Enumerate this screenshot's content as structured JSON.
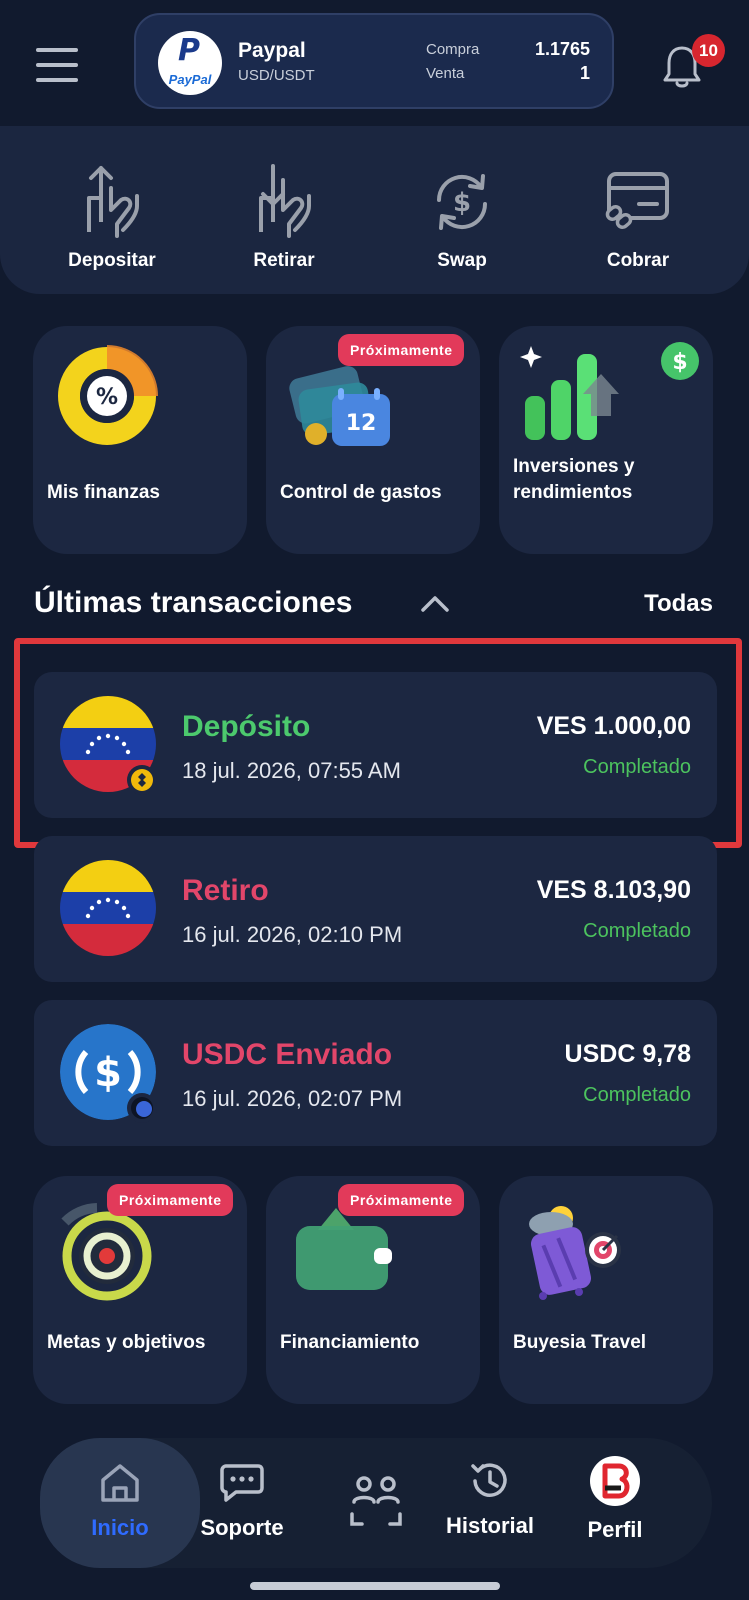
{
  "header": {
    "rate": {
      "name": "Paypal",
      "pair": "USD/USDT",
      "buy_label": "Compra",
      "buy_value": "1.1765",
      "sell_label": "Venta",
      "sell_value": "1"
    },
    "notifications_count": "10"
  },
  "actions": [
    {
      "label": "Depositar",
      "icon": "deposit-hand-icon"
    },
    {
      "label": "Retirar",
      "icon": "withdraw-hand-icon"
    },
    {
      "label": "Swap",
      "icon": "swap-dollar-icon"
    },
    {
      "label": "Cobrar",
      "icon": "card-link-icon"
    }
  ],
  "features_top": [
    {
      "title": "Mis finanzas",
      "badge": ""
    },
    {
      "title": "Control de gastos",
      "badge": "Próximamente"
    },
    {
      "title": "Inversiones y rendimientos",
      "badge": ""
    }
  ],
  "transactions": {
    "title": "Últimas transacciones",
    "all_label": "Todas",
    "items": [
      {
        "type": "Depósito",
        "date": "18 jul. 2026, 07:55 AM",
        "amount": "VES 1.000,00",
        "status": "Completado",
        "type_color": "#4cc96d"
      },
      {
        "type": "Retiro",
        "date": "16 jul. 2026, 02:10 PM",
        "amount": "VES 8.103,90",
        "status": "Completado",
        "type_color": "#e2466a"
      },
      {
        "type": "USDC Enviado",
        "date": "16 jul. 2026, 02:07 PM",
        "amount": "USDC 9,78",
        "status": "Completado",
        "type_color": "#e2466a"
      }
    ]
  },
  "features_bottom": [
    {
      "title": "Metas y objetivos",
      "badge": "Próximamente"
    },
    {
      "title": "Financiamiento",
      "badge": "Próximamente"
    },
    {
      "title": "Buyesia Travel",
      "badge": ""
    }
  ],
  "nav": [
    {
      "label": "Inicio",
      "icon": "home-icon",
      "active": true
    },
    {
      "label": "Soporte",
      "icon": "chat-icon"
    },
    {
      "label": "",
      "icon": "scan-icon"
    },
    {
      "label": "Historial",
      "icon": "history-icon"
    },
    {
      "label": "Perfil",
      "icon": "profile-logo-icon"
    }
  ],
  "colors": {
    "background": "#111a2e",
    "card": "#1c2741",
    "positive": "#4cc96d",
    "negative": "#e2466a",
    "badge": "#e23a5a",
    "nav_active": "#2f6bff"
  }
}
